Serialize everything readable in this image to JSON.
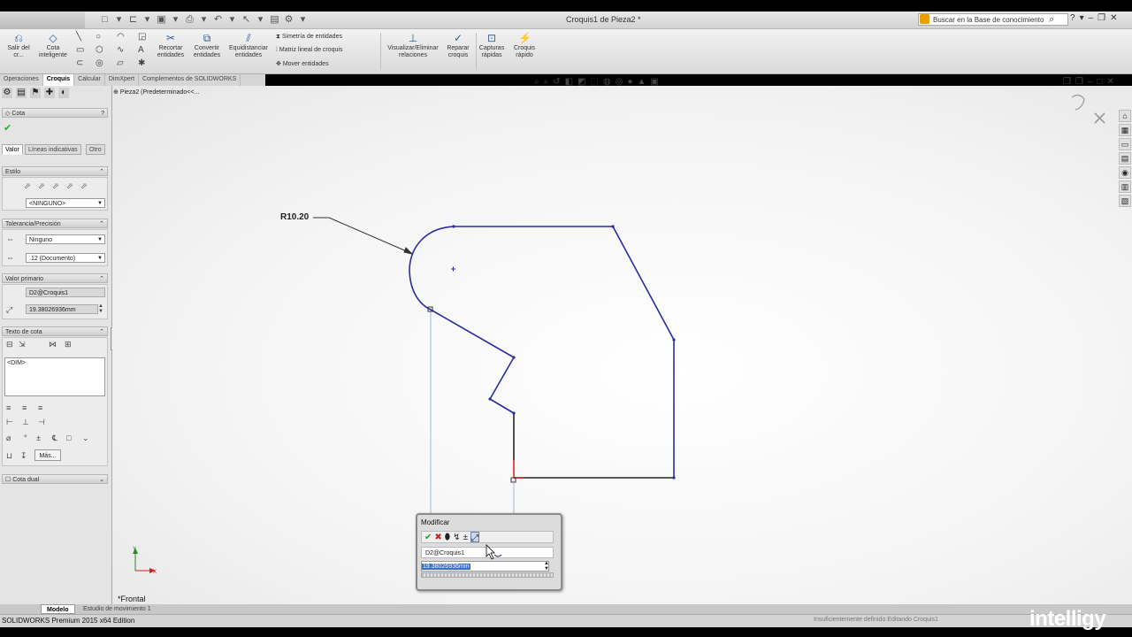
{
  "window": {
    "title": "Croquis1 de Pieza2 *",
    "search_placeholder": "Buscar en la Base de conocimiento"
  },
  "commands": {
    "exit_sketch": "Salir del cr...",
    "smart_dimension": "Cota inteligente",
    "trim": "Recortar entidades",
    "convert": "Convertir entidades",
    "offset": "Equidistanciar entidades",
    "mirror": "Simetría de entidades",
    "linear_pattern": "Matriz lineal de croquis",
    "move": "Mover entidades",
    "display_relations": "Visualizar/Eliminar relaciones",
    "repair": "Reparar croquis",
    "quick_snaps": "Capturas rápidas",
    "rapid_sketch": "Croquis rápido"
  },
  "tabs": [
    "Operaciones",
    "Croquis",
    "Calcular",
    "DimXpert",
    "Complementos de SOLIDWORKS"
  ],
  "active_tab": 1,
  "property_manager": {
    "title": "Cota",
    "ptabs": [
      "Valor",
      "Líneas indicativas",
      "Otro"
    ],
    "style_label": "Estilo",
    "style_value": "<NINGUNO>",
    "tolerance_label": "Tolerancia/Precisión",
    "tolerance_value": "Ninguno",
    "precision_value": ".12 (Documento)",
    "primary_label": "Valor primario",
    "primary_name": "D2@Croquis1",
    "primary_value": "19.38026936mm",
    "text_label": "Texto de cota",
    "text_value": "<DIM>",
    "more_button": "Más...",
    "dual_label": "Cota dual"
  },
  "breadcrumb": "Pieza2  (Predeterminado<<...",
  "graphics": {
    "dimension_label": "R10.20",
    "view_label": "*Frontal"
  },
  "modify_dialog": {
    "title": "Modificar",
    "name": "D2@Croquis1",
    "value": "19.38026936mm"
  },
  "model_tabs": [
    "Modelo",
    "Estudio de movimiento 1"
  ],
  "status": {
    "left": "SOLIDWORKS Premium 2015 x64 Edition",
    "right": "Insuficientemente definido     Editando Croquis1"
  },
  "watermark": "intelligy",
  "colors": {
    "sketch_line": "#2b2ba0",
    "extension_line": "#9fb7e0",
    "selection_highlight": "#3a6fc8"
  }
}
